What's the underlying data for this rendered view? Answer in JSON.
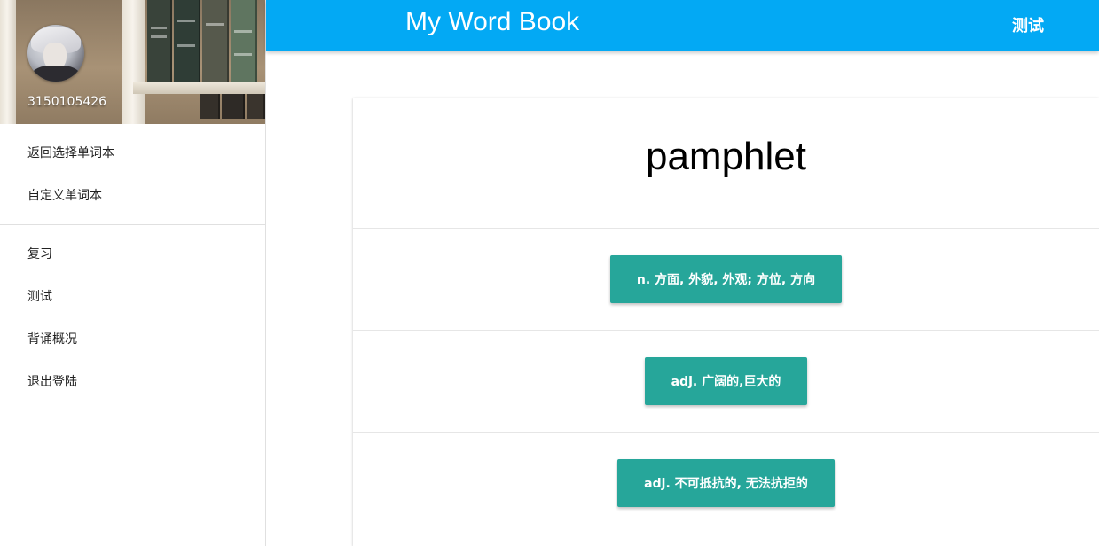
{
  "app": {
    "title": "My Word Book",
    "header_action": "测试",
    "accent_color": "#03a9f4",
    "button_color": "#26a69a"
  },
  "user": {
    "id": "3150105426",
    "avatar_icon": "user-avatar"
  },
  "sidebar": {
    "primary_items": [
      {
        "label": "返回选择单词本"
      },
      {
        "label": "自定义单词本"
      }
    ],
    "secondary_items": [
      {
        "label": "复习"
      },
      {
        "label": "测试"
      },
      {
        "label": "背诵概况"
      },
      {
        "label": "退出登陆"
      }
    ]
  },
  "quiz": {
    "word": "pamphlet",
    "options": [
      {
        "label": "n. 方面, 外貌, 外观; 方位, 方向"
      },
      {
        "label": "adj. 广阔的,巨大的"
      },
      {
        "label": "adj. 不可抵抗的, 无法抗拒的"
      }
    ]
  }
}
